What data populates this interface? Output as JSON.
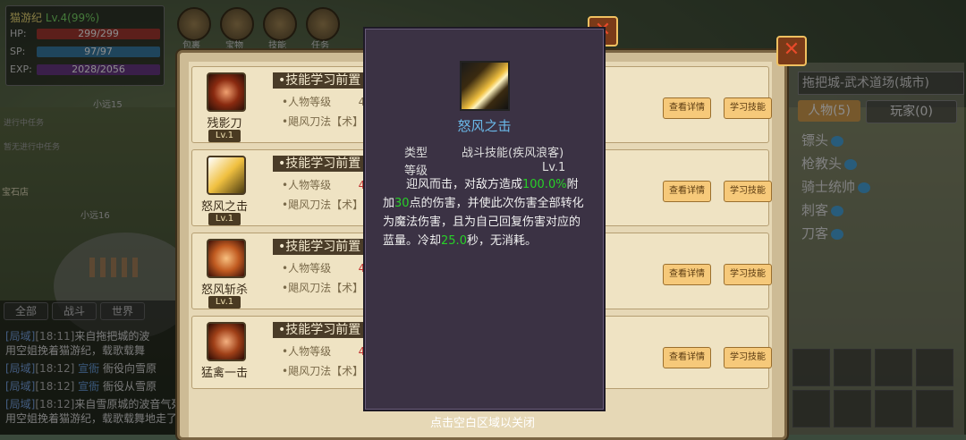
{
  "player": {
    "name": "猫游纪",
    "level_text": "Lv.4(99%)",
    "hp_label": "HP:",
    "hp": "299/299",
    "sp_label": "SP:",
    "sp": "97/97",
    "exp_label": "EXP:",
    "exp": "2028/2056"
  },
  "top_menu": [
    "包裹",
    "宝物",
    "技能",
    "任务"
  ],
  "top_right_labels": [
    "界",
    "首"
  ],
  "side": {
    "xiaoyuan15": "小远15",
    "xiaoyuan16": "小远16",
    "task_tab": "进行中任务",
    "task_empty": "暂无进行中任务",
    "shop": "宝石店"
  },
  "chat": {
    "tabs": [
      "全部",
      "战斗",
      "世界"
    ],
    "messages": [
      {
        "ch": "[局域]",
        "time": "[18:11]",
        "text": "来自拖把城的波",
        "cont": "用空姐挽着猫游纪，载歌载舞"
      },
      {
        "ch": "[局域]",
        "time": "[18:12]",
        "hl": "宣衙",
        "text": "衙役向雪原"
      },
      {
        "ch": "[局域]",
        "time": "[18:12]",
        "hl": "宣衙",
        "text": "衙役从雪原"
      },
      {
        "ch": "[局域]",
        "time": "[18:12]",
        "text": "来自雪原城的波音气死麦号飞机落地，专",
        "cont": "用空姐挽着猫游纪，载歌载舞地走了下来"
      }
    ]
  },
  "right_panel": {
    "location": "拖把城-武术道场(城市)",
    "tab_npc": "人物(5)",
    "tab_player": "玩家(0)",
    "npcs": [
      "镖头",
      "枪教头",
      "骑士统帅",
      "刺客",
      "刀客"
    ]
  },
  "skill_list": {
    "req_title": "•技能学习前置",
    "req_level": "•人物等级",
    "req_level_val": "4/",
    "req_skill": "•飓风刀法【术】",
    "btn_detail": "查看详情",
    "btn_learn": "学习技能",
    "skills": [
      {
        "name": "残影刀",
        "lv": "Lv.1"
      },
      {
        "name": "怒风之击",
        "lv": "Lv.1"
      },
      {
        "name": "怒风斩杀",
        "lv": "Lv.1"
      },
      {
        "name": "猛禽一击",
        "lv": "Lv.1"
      }
    ]
  },
  "tooltip": {
    "name": "怒风之击",
    "type_label": "类型",
    "type_value": "战斗技能(疾风浪客)",
    "level_label": "等级",
    "level_value": "Lv.1",
    "d1": "迎风而击，对敌方造成",
    "d2": "100.0%",
    "d3": "附加",
    "d4": "30",
    "d5": "点的伤害，并使此次伤害全部转化为魔法伤害，且为自己回复伤害对应的蓝量。冷却",
    "d6": "25.0",
    "d7": "秒，无消耗。"
  },
  "close_hint": "点击空白区域以关闭",
  "colors": {
    "highlight": "#28d028",
    "skill_name": "#6ab8e8",
    "tooltip_bg": "#3b3244"
  }
}
